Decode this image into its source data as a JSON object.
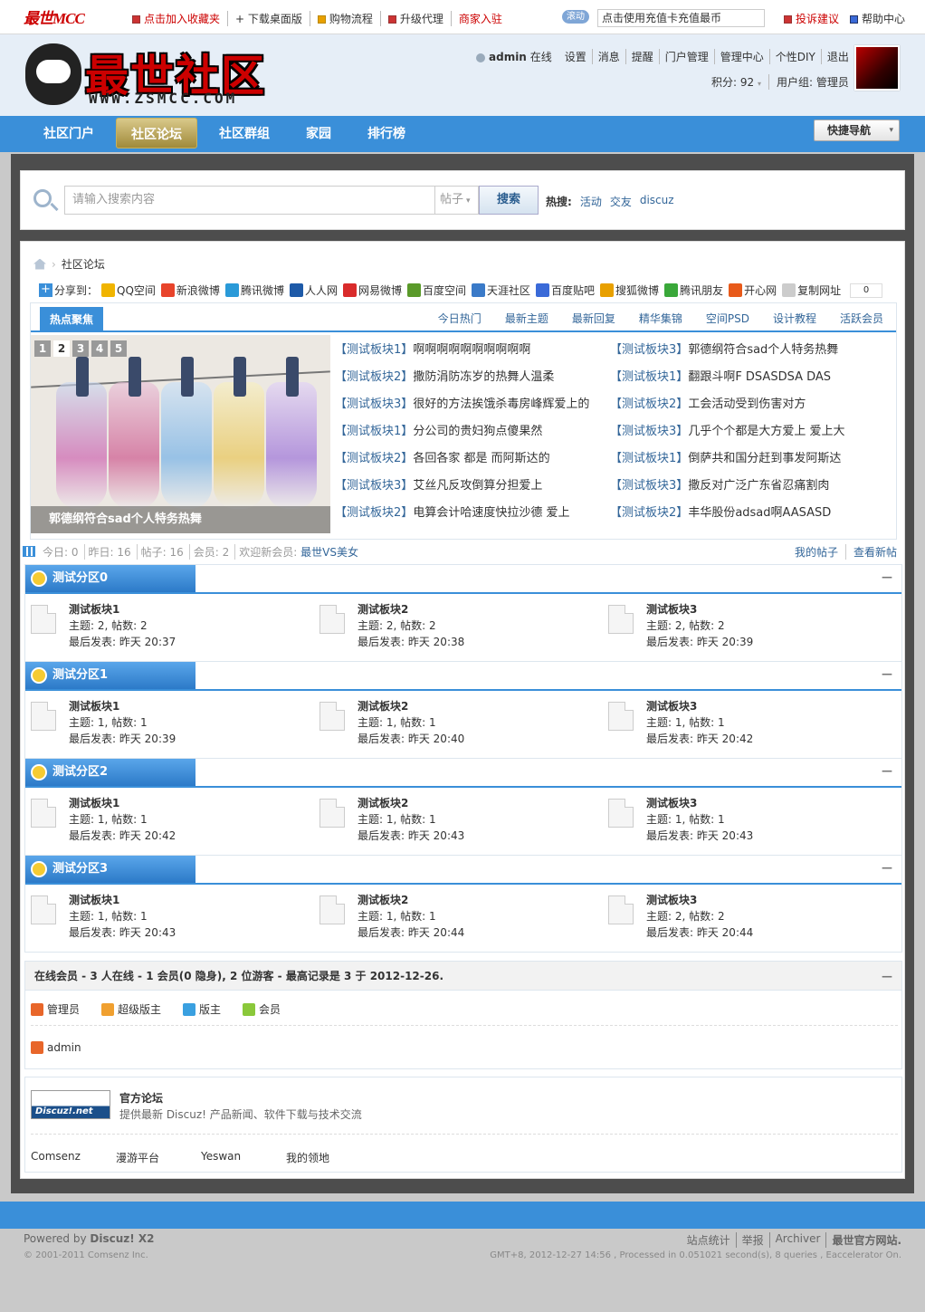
{
  "topbar": {
    "brand": "最世MCC",
    "links": [
      "点击加入收藏夹",
      "+ 下载桌面版",
      "购物流程",
      "升级代理",
      "商家入驻"
    ],
    "scroll_label": "滚动",
    "notice": "点击使用充值卡充值最币",
    "right_links": [
      "投诉建议",
      "帮助中心"
    ]
  },
  "header": {
    "logo_text": "最世社区",
    "logo_url": "WWW.ZSMCC.COM",
    "username": "admin",
    "status": "在线",
    "menu": [
      "设置",
      "消息",
      "提醒",
      "门户管理",
      "管理中心",
      "个性DIY",
      "退出"
    ],
    "credit": "积分: 92",
    "usergroup": "用户组: 管理员"
  },
  "nav": {
    "items": [
      "社区门户",
      "社区论坛",
      "社区群组",
      "家园",
      "排行榜"
    ],
    "active": 1,
    "quicknav": "快捷导航"
  },
  "search": {
    "placeholder": "请输入搜索内容",
    "type": "帖子",
    "button": "搜索",
    "hot_label": "热搜:",
    "hot": [
      "活动",
      "交友",
      "discuz"
    ]
  },
  "breadcrumb": "社区论坛",
  "share": {
    "label": "分享到：",
    "items": [
      {
        "name": "QQ空间",
        "color": "#f0b400"
      },
      {
        "name": "新浪微博",
        "color": "#e8442b"
      },
      {
        "name": "腾讯微博",
        "color": "#2a9ad8"
      },
      {
        "name": "人人网",
        "color": "#1e5aa8"
      },
      {
        "name": "网易微博",
        "color": "#d92b2b"
      },
      {
        "name": "百度空间",
        "color": "#5a9a2a"
      },
      {
        "name": "天涯社区",
        "color": "#3a7ac8"
      },
      {
        "name": "百度贴吧",
        "color": "#3a6ad8"
      },
      {
        "name": "搜狐微博",
        "color": "#e8a000"
      },
      {
        "name": "腾讯朋友",
        "color": "#3aa83a"
      },
      {
        "name": "开心网",
        "color": "#e85a1a"
      },
      {
        "name": "复制网址",
        "color": "#cccccc"
      }
    ],
    "count": "0"
  },
  "hot": {
    "first_tab": "热点聚焦",
    "tabs": [
      "今日热门",
      "最新主题",
      "最新回复",
      "精华集锦",
      "空间PSD",
      "设计教程",
      "活跃会员"
    ],
    "slide_nums": [
      "1",
      "2",
      "3",
      "4",
      "5"
    ],
    "slide_active": 1,
    "caption": "郭德纲符合sad个人特务热舞",
    "left": [
      [
        "测试板块1",
        "啊啊啊啊啊啊啊啊啊啊"
      ],
      [
        "测试板块2",
        "撒防涓防冻岁的热舞人温柔"
      ],
      [
        "测试板块3",
        "很好的方法挨饿杀毒房峰辉爱上的"
      ],
      [
        "测试板块1",
        "分公司的贵妇狗点傻果然"
      ],
      [
        "测试板块2",
        "各回各家 都是 而阿斯达的"
      ],
      [
        "测试板块3",
        "艾丝凡反攻倒算分担爱上"
      ],
      [
        "测试板块2",
        "电算会计哈速度快拉沙德 爱上"
      ]
    ],
    "right": [
      [
        "测试板块3",
        "郭德纲符合sad个人特务热舞"
      ],
      [
        "测试板块1",
        "翻跟斗啊F DSASDSA DAS"
      ],
      [
        "测试板块2",
        "工会活动受到伤害对方"
      ],
      [
        "测试板块3",
        "几乎个个都是大方爱上 爱上大"
      ],
      [
        "测试板块1",
        "倒萨共和国分赶到事发阿斯达"
      ],
      [
        "测试板块3",
        "撒反对广泛广东省忍痛割肉"
      ],
      [
        "测试板块2",
        "丰华股份adsad啊AASASD"
      ]
    ]
  },
  "stats": {
    "today": "今日: 0",
    "yesterday": "昨日: 16",
    "posts": "帖子: 16",
    "members": "会员: 2",
    "welcome": "欢迎新会员:",
    "newest": "最世VS美女",
    "links": [
      "我的帖子",
      "查看新帖"
    ]
  },
  "sections": [
    {
      "title": "测试分区0",
      "forums": [
        {
          "name": "测试板块1",
          "stat": "主题: 2, 帖数: 2",
          "last": "最后发表: 昨天 20:37"
        },
        {
          "name": "测试板块2",
          "stat": "主题: 2, 帖数: 2",
          "last": "最后发表: 昨天 20:38"
        },
        {
          "name": "测试板块3",
          "stat": "主题: 2, 帖数: 2",
          "last": "最后发表: 昨天 20:39"
        }
      ]
    },
    {
      "title": "测试分区1",
      "forums": [
        {
          "name": "测试板块1",
          "stat": "主题: 1, 帖数: 1",
          "last": "最后发表: 昨天 20:39"
        },
        {
          "name": "测试板块2",
          "stat": "主题: 1, 帖数: 1",
          "last": "最后发表: 昨天 20:40"
        },
        {
          "name": "测试板块3",
          "stat": "主题: 1, 帖数: 1",
          "last": "最后发表: 昨天 20:42"
        }
      ]
    },
    {
      "title": "测试分区2",
      "forums": [
        {
          "name": "测试板块1",
          "stat": "主题: 1, 帖数: 1",
          "last": "最后发表: 昨天 20:42"
        },
        {
          "name": "测试板块2",
          "stat": "主题: 1, 帖数: 1",
          "last": "最后发表: 昨天 20:43"
        },
        {
          "name": "测试板块3",
          "stat": "主题: 1, 帖数: 1",
          "last": "最后发表: 昨天 20:43"
        }
      ]
    },
    {
      "title": "测试分区3",
      "forums": [
        {
          "name": "测试板块1",
          "stat": "主题: 1, 帖数: 1",
          "last": "最后发表: 昨天 20:43"
        },
        {
          "name": "测试板块2",
          "stat": "主题: 1, 帖数: 1",
          "last": "最后发表: 昨天 20:44"
        },
        {
          "name": "测试板块3",
          "stat": "主题: 2, 帖数: 2",
          "last": "最后发表: 昨天 20:44"
        }
      ]
    }
  ],
  "online": {
    "title": "在线会员 - 3 人在线 - 1 会员(0 隐身), 2 位游客 - 最高记录是 3 于 2012-12-26.",
    "legend": [
      {
        "name": "管理员",
        "color": "#e8662a"
      },
      {
        "name": "超级版主",
        "color": "#f0a030"
      },
      {
        "name": "版主",
        "color": "#3aa0e0"
      },
      {
        "name": "会员",
        "color": "#8ac83a"
      }
    ],
    "user": "admin"
  },
  "links": {
    "logo": "Discuz!.net",
    "title": "官方论坛",
    "desc": "提供最新 Discuz! 产品新闻、软件下载与技术交流",
    "text_links": [
      "Comsenz",
      "漫游平台",
      "Yeswan",
      "我的领地"
    ]
  },
  "footer": {
    "powered": "Powered by",
    "product": "Discuz! X2",
    "copyright": "© 2001-2011 Comsenz Inc.",
    "links": [
      "站点统计",
      "举报",
      "Archiver",
      "最世官方网站."
    ],
    "info": "GMT+8, 2012-12-27 14:56 , Processed in 0.051021 second(s), 8 queries , Eaccelerator On."
  }
}
